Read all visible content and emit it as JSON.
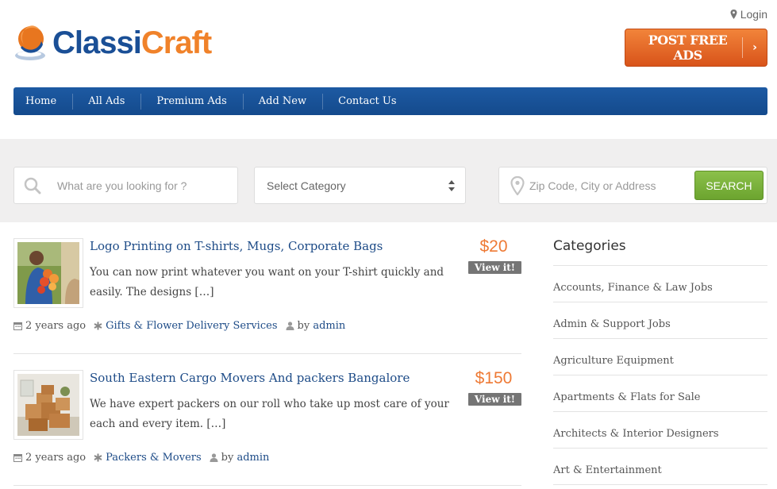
{
  "header": {
    "logo_part1": "Classi",
    "logo_part2": "Craft",
    "login_label": "Login",
    "post_button_label": "POST FREE ADS",
    "post_button_arrow": "›"
  },
  "nav": {
    "items": [
      {
        "label": "Home"
      },
      {
        "label": "All Ads"
      },
      {
        "label": "Premium Ads"
      },
      {
        "label": "Add New"
      },
      {
        "label": "Contact Us"
      }
    ]
  },
  "search": {
    "keyword_placeholder": "What are you looking for ?",
    "category_selected": "Select Category",
    "location_placeholder": "Zip Code, City or Address",
    "search_button_label": "SEARCH"
  },
  "listings": [
    {
      "title": "Logo Printing on T-shirts, Mugs, Corporate Bags",
      "description": "You can now print whatever you want on your T-shirt quickly and easily. The designs […]",
      "price": "$20",
      "view_label": "View it!",
      "posted": "2 years ago",
      "category": "Gifts & Flower Delivery Services",
      "by_label": "by",
      "author": "admin",
      "thumb_icon": "flower-delivery-photo"
    },
    {
      "title": "South Eastern Cargo Movers And packers Bangalore",
      "description": "We have expert packers on our roll who take up most care of your each and every item. […]",
      "price": "$150",
      "view_label": "View it!",
      "posted": "2 years ago",
      "category": "Packers & Movers",
      "by_label": "by",
      "author": "admin",
      "thumb_icon": "cardboard-boxes-photo"
    }
  ],
  "sidebar": {
    "title": "Categories",
    "categories": [
      {
        "label": "Accounts, Finance & Law Jobs"
      },
      {
        "label": "Admin & Support Jobs"
      },
      {
        "label": "Agriculture Equipment"
      },
      {
        "label": "Apartments & Flats for Sale"
      },
      {
        "label": "Architects & Interior Designers"
      },
      {
        "label": "Art & Entertainment"
      }
    ]
  },
  "colors": {
    "brand_blue": "#1a4f96",
    "brand_orange": "#f0822a",
    "search_green": "#7cb43c",
    "price_orange": "#ee7a35"
  }
}
